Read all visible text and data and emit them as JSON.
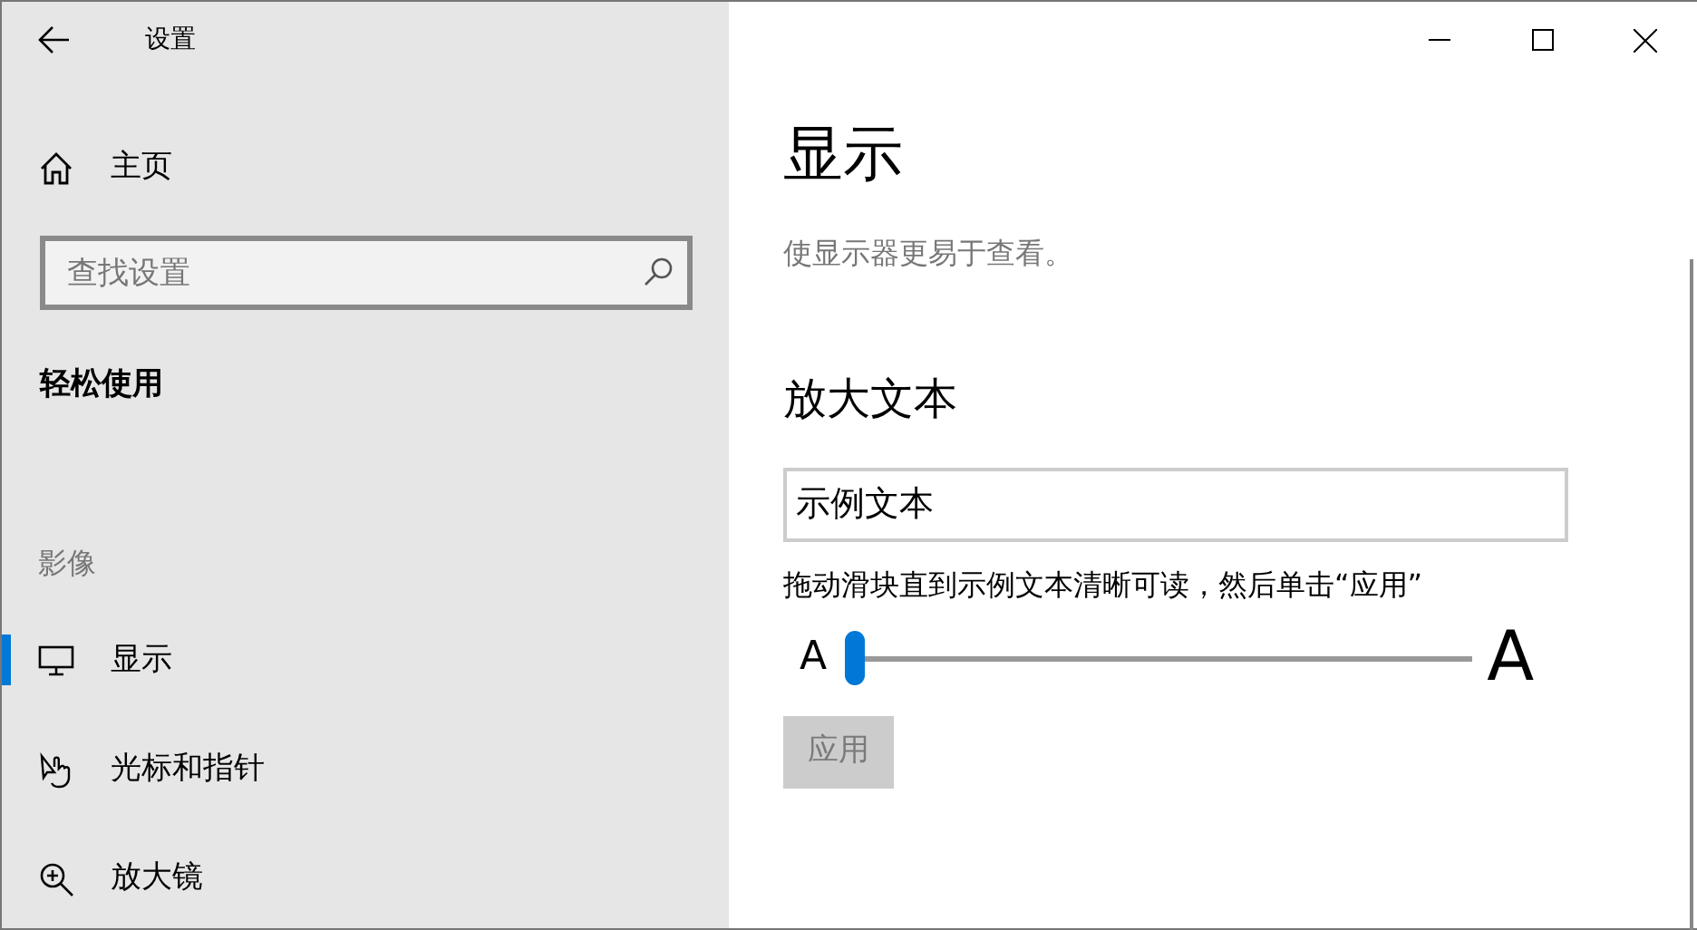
{
  "window": {
    "title": "设置"
  },
  "sidebar": {
    "home": "主页",
    "search": {
      "placeholder": "查找设置"
    },
    "section": "轻松使用",
    "group": "影像",
    "items": [
      {
        "label": "显示",
        "selected": true
      },
      {
        "label": "光标和指针",
        "selected": false
      },
      {
        "label": "放大镜",
        "selected": false
      }
    ]
  },
  "page": {
    "title": "显示",
    "description": "使显示器更易于查看。",
    "heading": "放大文本",
    "sample": "示例文本",
    "instruction": "拖动滑块直到示例文本清晰可读，然后单击“应用”",
    "slider": {
      "min_label": "A",
      "max_label": "A",
      "level": 0
    },
    "apply": {
      "label": "应用",
      "disabled": true
    }
  }
}
